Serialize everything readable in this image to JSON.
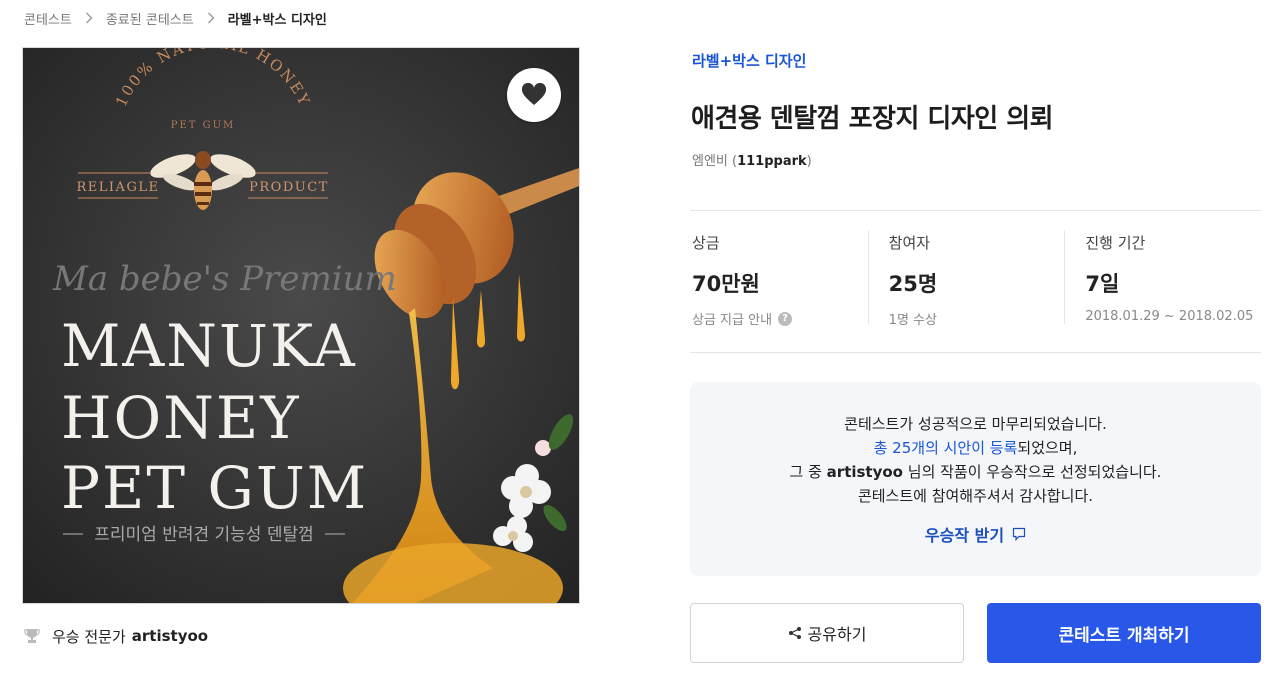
{
  "breadcrumb": {
    "items": [
      {
        "label": "콘테스트"
      },
      {
        "label": "종료된 콘테스트"
      },
      {
        "label": "라벨+박스 디자인"
      }
    ]
  },
  "product_image": {
    "badge_top": "100% NATURAL HONEY",
    "badge_sub": "PET GUM",
    "badge_left": "RELIAGLE",
    "badge_right": "PRODUCT",
    "script_line": "Ma bebe's Premium",
    "headline": [
      "MANUKA",
      "HONEY",
      "PET GUM"
    ],
    "korean_line": "프리미엄 반려견 기능성 덴탈껌",
    "icon": "heart-icon"
  },
  "winner": {
    "icon": "trophy-icon",
    "prefix": "우승 전문가",
    "name": "artistyoo"
  },
  "contest": {
    "category": "라벨+박스 디자인",
    "title": "애견용 덴탈껌 포장지 디자인 의뢰",
    "host_name": "엠엔비 (",
    "host_id": "111ppark",
    "host_close": ")"
  },
  "stats": [
    {
      "label": "상금",
      "value": "70만원",
      "sub": "상금 지급 안내"
    },
    {
      "label": "참여자",
      "value": "25명",
      "sub": "1명 수상"
    },
    {
      "label": "진행 기간",
      "value": "7일",
      "sub": "2018.01.29 ~ 2018.02.05"
    }
  ],
  "notice": {
    "line1": "콘테스트가 성공적으로 마무리되었습니다.",
    "line2_link": "총 25개의 시안이 등록",
    "line2_rest": "되었으며,",
    "line3_pre": "그 중 ",
    "line3_name": "artistyoo",
    "line3_post": " 님의 작품이 우승작으로 선정되었습니다.",
    "line4": "콘테스트에 참여해주셔서 감사합니다.",
    "cta": "우승작 받기"
  },
  "actions": {
    "share": "공유하기",
    "host": "콘테스트 개최하기"
  },
  "colors": {
    "accent_blue": "#2958e8",
    "link_blue": "#1a55d6",
    "notice_bg": "#f4f6f9",
    "honey": "#e8a21a"
  }
}
